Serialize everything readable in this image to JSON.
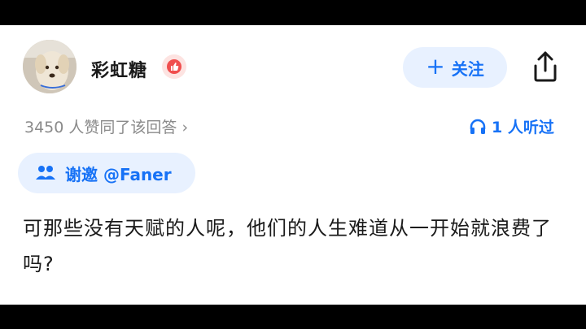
{
  "author": {
    "name": "彩虹糖",
    "badge_icon": "thumbs-up-badge"
  },
  "follow_button": {
    "label": "关注",
    "plus": "+"
  },
  "stats": {
    "likes": "3450 人赞同了该回答",
    "likes_arrow": "›",
    "listened": "1 人听过"
  },
  "invite": {
    "label": "谢邀 @Faner"
  },
  "content": {
    "text": "可那些没有天赋的人呢，他们的人生难道从一开始就浪费了吗?"
  },
  "colors": {
    "accent": "#1772f6",
    "accent_bg": "#e8f1ff",
    "muted_text": "#8a8a8a"
  }
}
